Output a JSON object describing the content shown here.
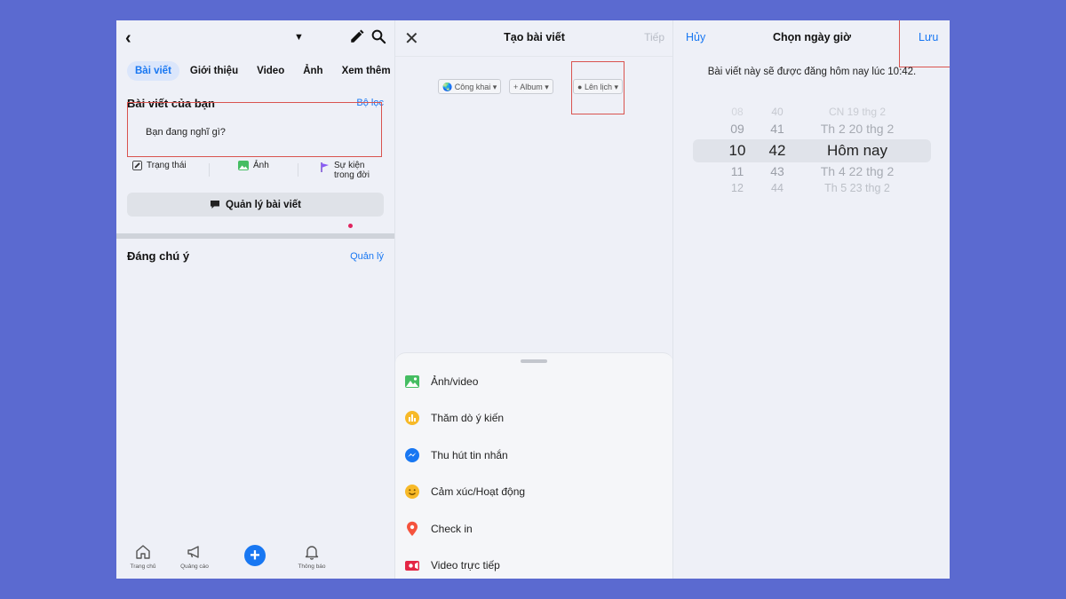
{
  "panel1": {
    "tabs": [
      "Bài viết",
      "Giới thiệu",
      "Video",
      "Ảnh",
      "Xem thêm"
    ],
    "section_title": "Bài viết của bạn",
    "filter_label": "Bộ lọc",
    "compose_placeholder": "Bạn đang nghĩ gì?",
    "actions": [
      {
        "label": "Trạng thái",
        "icon": "edit-icon"
      },
      {
        "label": "Ảnh",
        "icon": "photo-icon"
      },
      {
        "label": "Sự kiện trong đời",
        "icon": "flag-icon"
      }
    ],
    "manage_posts_label": "Quản lý bài viết",
    "notable_title": "Đáng chú ý",
    "manage_label": "Quản lý",
    "nav": [
      {
        "label": "Trang chủ",
        "icon": "home-icon"
      },
      {
        "label": "Quảng cáo",
        "icon": "megaphone-icon"
      },
      {
        "label": "",
        "icon": "plus-icon"
      },
      {
        "label": "Thông báo",
        "icon": "bell-icon"
      }
    ]
  },
  "panel2": {
    "title": "Tạo bài viết",
    "next_label": "Tiếp",
    "audience_label": "Công khai",
    "album_label": "+ Album",
    "schedule_label": "Lên lịch",
    "sheet_items": [
      {
        "label": "Ảnh/video",
        "icon": "photo-video-icon",
        "color": "#45bd62"
      },
      {
        "label": "Thăm dò ý kiến",
        "icon": "poll-icon",
        "color": "#f7b928"
      },
      {
        "label": "Thu hút tin nhắn",
        "icon": "messenger-icon",
        "color": "#1877f2"
      },
      {
        "label": "Cảm xúc/Hoạt động",
        "icon": "emoji-icon",
        "color": "#f7b928"
      },
      {
        "label": "Check in",
        "icon": "location-pin-icon",
        "color": "#f5533d"
      },
      {
        "label": "Video trực tiếp",
        "icon": "live-video-icon",
        "color": "#e42645"
      }
    ]
  },
  "panel3": {
    "cancel_label": "Hủy",
    "title": "Chọn ngày giờ",
    "save_label": "Lưu",
    "description": "Bài viết này sẽ được đăng hôm nay lúc 10:42.",
    "picker_rows": [
      {
        "hour": "08",
        "minute": "40",
        "day": "CN 19 thg 2"
      },
      {
        "hour": "09",
        "minute": "41",
        "day": "Th 2 20 thg 2"
      },
      {
        "hour": "10",
        "minute": "42",
        "day": "Hôm nay"
      },
      {
        "hour": "11",
        "minute": "43",
        "day": "Th 4 22 thg 2"
      },
      {
        "hour": "12",
        "minute": "44",
        "day": "Th 5 23 thg 2"
      }
    ]
  },
  "colors": {
    "accent": "#1877f2",
    "highlight_border": "#d9534f",
    "background": "#5b6ad0"
  }
}
